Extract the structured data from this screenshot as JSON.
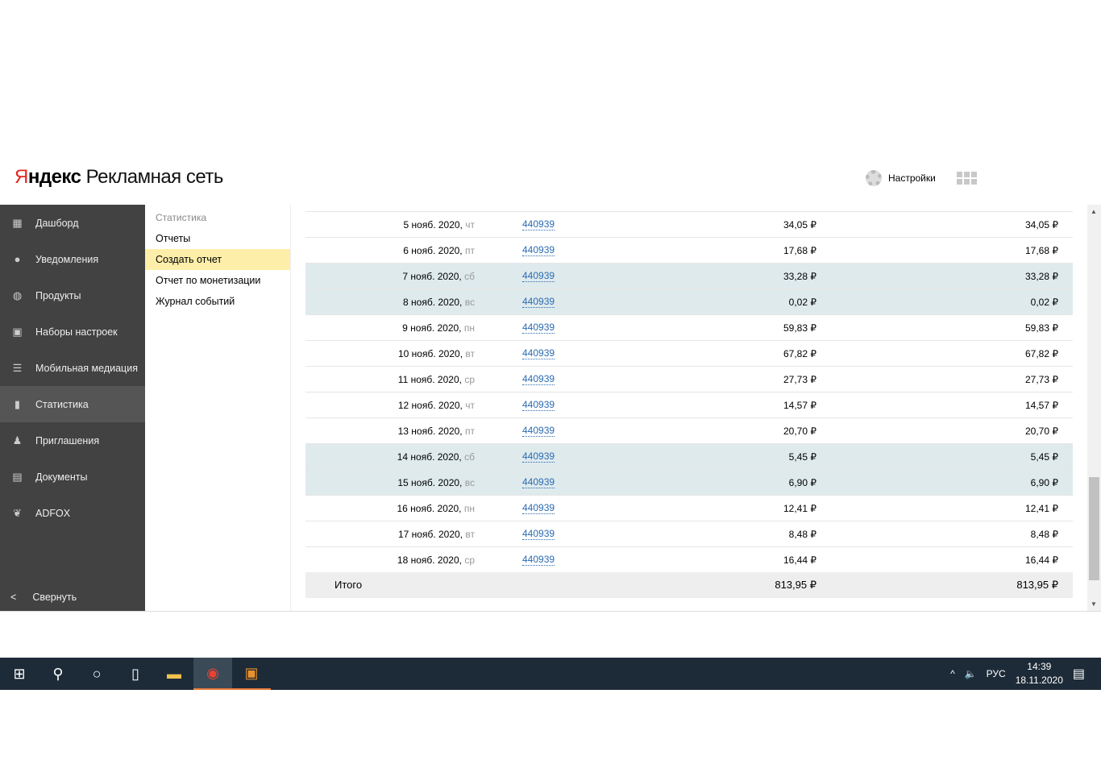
{
  "header": {
    "logo_brand": "Яндекс",
    "logo_product": "Рекламная сеть",
    "settings_label": "Настройки"
  },
  "sidebar": {
    "items": [
      {
        "label": "Дашборд",
        "icon": "dashboard-icon"
      },
      {
        "label": "Уведомления",
        "icon": "bulb-icon"
      },
      {
        "label": "Продукты",
        "icon": "products-icon"
      },
      {
        "label": "Наборы настроек",
        "icon": "presets-icon"
      },
      {
        "label": "Мобильная медиация",
        "icon": "mediation-icon"
      },
      {
        "label": "Статистика",
        "icon": "chart-icon",
        "active": true
      },
      {
        "label": "Приглашения",
        "icon": "invite-icon"
      },
      {
        "label": "Документы",
        "icon": "document-icon"
      },
      {
        "label": "ADFOX",
        "icon": "adfox-icon"
      }
    ],
    "collapse_label": "Свернуть"
  },
  "submenu": {
    "heading": "Статистика",
    "items": [
      "Отчеты",
      "Создать отчет",
      "Отчет по монетизации",
      "Журнал событий"
    ],
    "active_index": 1
  },
  "table": {
    "rows": [
      {
        "date": "5 нояб. 2020,",
        "dow": "чт",
        "id": "440939",
        "v1": "34,05 ₽",
        "v2": "34,05 ₽",
        "weekend": false
      },
      {
        "date": "6 нояб. 2020,",
        "dow": "пт",
        "id": "440939",
        "v1": "17,68 ₽",
        "v2": "17,68 ₽",
        "weekend": false
      },
      {
        "date": "7 нояб. 2020,",
        "dow": "сб",
        "id": "440939",
        "v1": "33,28 ₽",
        "v2": "33,28 ₽",
        "weekend": true
      },
      {
        "date": "8 нояб. 2020,",
        "dow": "вс",
        "id": "440939",
        "v1": "0,02 ₽",
        "v2": "0,02 ₽",
        "weekend": true
      },
      {
        "date": "9 нояб. 2020,",
        "dow": "пн",
        "id": "440939",
        "v1": "59,83 ₽",
        "v2": "59,83 ₽",
        "weekend": false
      },
      {
        "date": "10 нояб. 2020,",
        "dow": "вт",
        "id": "440939",
        "v1": "67,82 ₽",
        "v2": "67,82 ₽",
        "weekend": false
      },
      {
        "date": "11 нояб. 2020,",
        "dow": "ср",
        "id": "440939",
        "v1": "27,73 ₽",
        "v2": "27,73 ₽",
        "weekend": false
      },
      {
        "date": "12 нояб. 2020,",
        "dow": "чт",
        "id": "440939",
        "v1": "14,57 ₽",
        "v2": "14,57 ₽",
        "weekend": false
      },
      {
        "date": "13 нояб. 2020,",
        "dow": "пт",
        "id": "440939",
        "v1": "20,70 ₽",
        "v2": "20,70 ₽",
        "weekend": false
      },
      {
        "date": "14 нояб. 2020,",
        "dow": "сб",
        "id": "440939",
        "v1": "5,45 ₽",
        "v2": "5,45 ₽",
        "weekend": true
      },
      {
        "date": "15 нояб. 2020,",
        "dow": "вс",
        "id": "440939",
        "v1": "6,90 ₽",
        "v2": "6,90 ₽",
        "weekend": true
      },
      {
        "date": "16 нояб. 2020,",
        "dow": "пн",
        "id": "440939",
        "v1": "12,41 ₽",
        "v2": "12,41 ₽",
        "weekend": false
      },
      {
        "date": "17 нояб. 2020,",
        "dow": "вт",
        "id": "440939",
        "v1": "8,48 ₽",
        "v2": "8,48 ₽",
        "weekend": false
      },
      {
        "date": "18 нояб. 2020,",
        "dow": "ср",
        "id": "440939",
        "v1": "16,44 ₽",
        "v2": "16,44 ₽",
        "weekend": false
      }
    ],
    "total": {
      "label": "Итого",
      "v1": "813,95 ₽",
      "v2": "813,95 ₽"
    }
  },
  "taskbar": {
    "lang": "РУС",
    "time": "14:39",
    "date": "18.11.2020"
  }
}
